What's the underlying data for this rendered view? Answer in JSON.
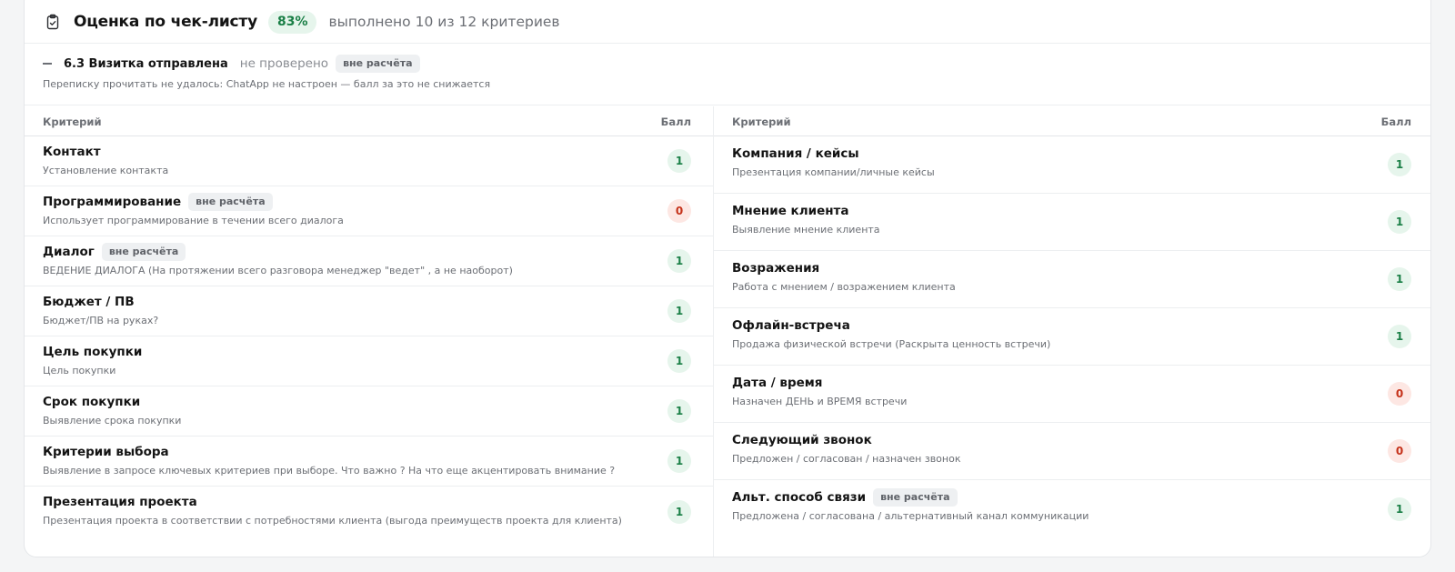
{
  "header": {
    "title": "Оценка по чек-листу",
    "percent": "83%",
    "subtitle": "выполнено 10 из 12 критериев"
  },
  "skipped": {
    "name": "6.3 Визитка отправлена",
    "status": "не проверено",
    "tag": "вне расчёта",
    "note": "Переписку прочитать не удалось: ChatApp не настроен — балл за это не снижается"
  },
  "table_headers": {
    "criterion": "Критерий",
    "score": "Балл"
  },
  "left_rows": [
    {
      "name": "Контакт",
      "desc": "Установление контакта",
      "score": "1",
      "tag": ""
    },
    {
      "name": "Программирование",
      "desc": "Использует программирование в течении всего диалога",
      "score": "0",
      "tag": "вне расчёта"
    },
    {
      "name": "Диалог",
      "desc": "ВЕДЕНИЕ ДИАЛОГА (На протяжении всего разговора менеджер \"ведет\" , а не наоборот)",
      "score": "1",
      "tag": "вне расчёта"
    },
    {
      "name": "Бюджет / ПВ",
      "desc": "Бюджет/ПВ на руках?",
      "score": "1",
      "tag": ""
    },
    {
      "name": "Цель покупки",
      "desc": "Цель покупки",
      "score": "1",
      "tag": ""
    },
    {
      "name": "Срок покупки",
      "desc": "Выявление срока покупки",
      "score": "1",
      "tag": ""
    },
    {
      "name": "Критерии выбора",
      "desc": "Выявление в запросе ключевых критериев при выборе. Что важно ? На что еще акцентировать внимание ?",
      "score": "1",
      "tag": ""
    },
    {
      "name": "Презентация проекта",
      "desc": "Презентация проекта в соответствии с потребностями клиента (выгода преимуществ проекта для клиента)",
      "score": "1",
      "tag": ""
    }
  ],
  "right_rows": [
    {
      "name": "Компания / кейсы",
      "desc": "Презентация компании/личные кейсы",
      "score": "1",
      "tag": ""
    },
    {
      "name": "Мнение клиента",
      "desc": "Выявление мнение клиента",
      "score": "1",
      "tag": ""
    },
    {
      "name": "Возражения",
      "desc": "Работа с мнением / возражением клиента",
      "score": "1",
      "tag": ""
    },
    {
      "name": "Офлайн-встреча",
      "desc": "Продажа физической встречи (Раскрыта ценность встречи)",
      "score": "1",
      "tag": ""
    },
    {
      "name": "Дата / время",
      "desc": "Назначен ДЕНЬ и ВРЕМЯ встречи",
      "score": "0",
      "tag": ""
    },
    {
      "name": "Следующий звонок",
      "desc": "Предложен / согласован / назначен звонок",
      "score": "0",
      "tag": ""
    },
    {
      "name": "Альт. способ связи",
      "desc": "Предложена / согласована / альтернативный канал коммуникации",
      "score": "1",
      "tag": "вне расчёта"
    }
  ],
  "colors": {
    "ok_bg": "#e6f5ec",
    "ok_fg": "#1a7f46",
    "bad_bg": "#fde7e3",
    "bad_fg": "#c5321a"
  },
  "icons": {
    "header": "clipboard-check-icon",
    "skipped": "dash-icon"
  }
}
